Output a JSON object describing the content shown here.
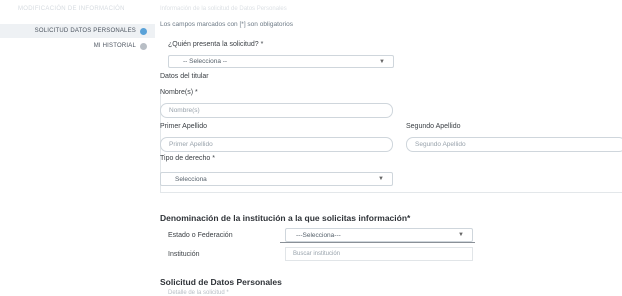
{
  "sidebar": {
    "faded_item": "MODIFICACIÓN DE INFORMACIÓN",
    "active_item": "SOLICITUD DATOS PERSONALES",
    "item": "MI HISTORIAL"
  },
  "main": {
    "faded_header": "Información de la solicitud de Datos Personales",
    "required_note": "Los campos marcados con [*] son obligatorios",
    "presenta": {
      "label": "¿Quién presenta la solicitud? *",
      "value": "-- Selecciona --"
    },
    "titular_heading": "Datos del titular",
    "nombre": {
      "label": "Nombre(s) *",
      "placeholder": "Nombre(s)"
    },
    "primer_apellido": {
      "label": "Primer Apellido",
      "placeholder": "Primer Apellido"
    },
    "segundo_apellido": {
      "label": "Segundo Apellido",
      "placeholder": "Segundo Apellido"
    },
    "tipo_derecho": {
      "label": "Tipo de derecho *",
      "value": "Selecciona"
    },
    "institucion_section": {
      "heading": "Denominación de la institución a la que solicitas información*",
      "estado_label": "Estado o Federación",
      "estado_value": "---Selecciona---",
      "institucion_label": "Institución",
      "institucion_placeholder": "Buscar institución"
    },
    "solicitud_section": {
      "heading": "Solicitud de Datos Personales",
      "detail_label": "Detalle de la solicitud *"
    }
  }
}
